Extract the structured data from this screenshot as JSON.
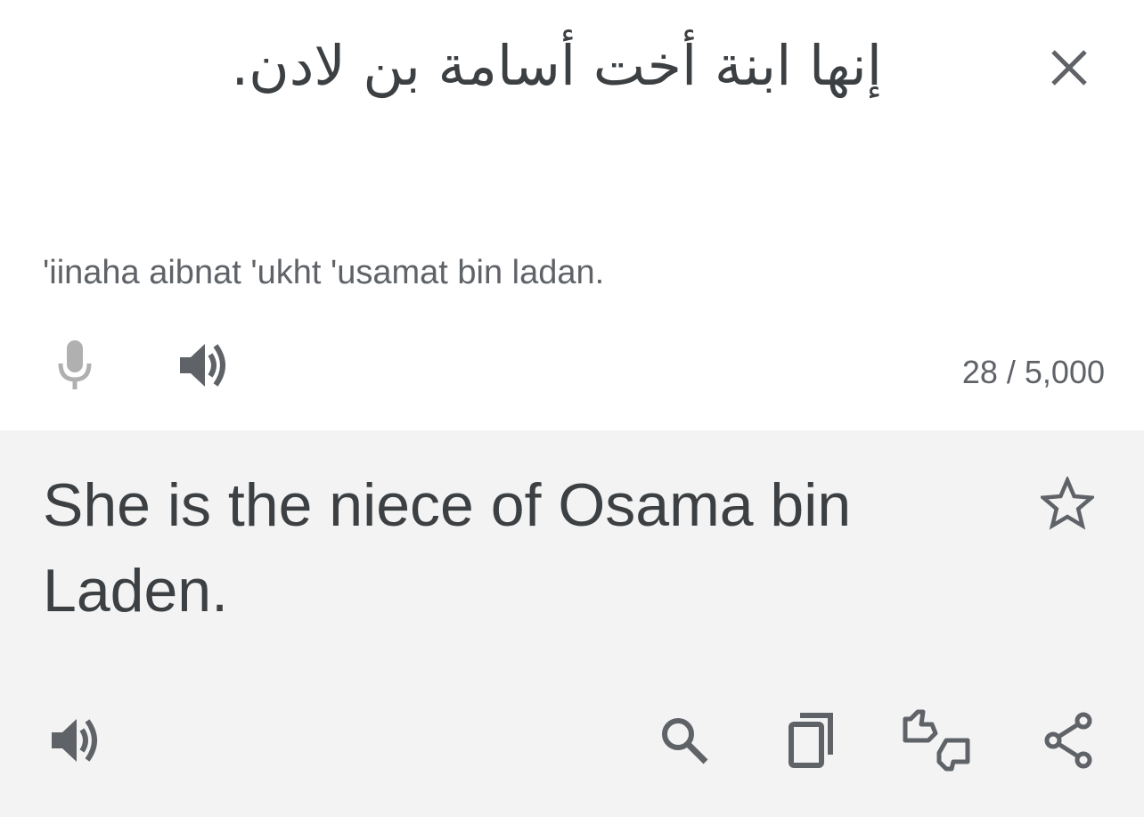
{
  "source": {
    "text": "إنها ابنة أخت أسامة بن لادن.",
    "transliteration": "'iinaha aibnat 'ukht 'usamat bin ladan.",
    "char_count": "28 / 5,000"
  },
  "target": {
    "text": "She is the niece of Osama bin Laden."
  },
  "icons": {
    "close": "close-icon",
    "mic": "microphone-icon",
    "speaker_source": "speaker-icon",
    "star": "star-outline-icon",
    "speaker_target": "speaker-icon",
    "search": "search-icon",
    "copy": "copy-icon",
    "feedback": "thumbs-feedback-icon",
    "share": "share-icon"
  },
  "colors": {
    "text_primary": "#3c4043",
    "text_secondary": "#5f6368",
    "icon_disabled": "#b0b0b0",
    "target_background": "#f3f3f3"
  }
}
